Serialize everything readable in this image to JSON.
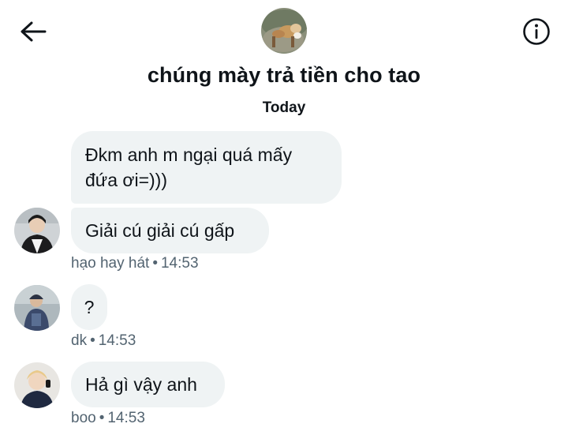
{
  "header": {
    "back_icon": "arrow-left-icon",
    "info_icon": "info-circle-icon",
    "group_name": "chúng mày trả tiền cho tao"
  },
  "date_separator": "Today",
  "messages": [
    {
      "text": "Đkm anh m ngại quá mấy đứa ơi=)))"
    },
    {
      "text": "Giải cú giải cú gấp",
      "sender": "hạo hay hát",
      "time": "14:53"
    },
    {
      "text": "?",
      "sender": "dk",
      "time": "14:53"
    },
    {
      "text": "Hả gì vậy anh",
      "sender": "boo",
      "time": "14:53"
    }
  ],
  "meta_separator": "•",
  "colors": {
    "bubble_bg": "#eff3f4",
    "text": "#0f1419",
    "meta_text": "#536471"
  }
}
